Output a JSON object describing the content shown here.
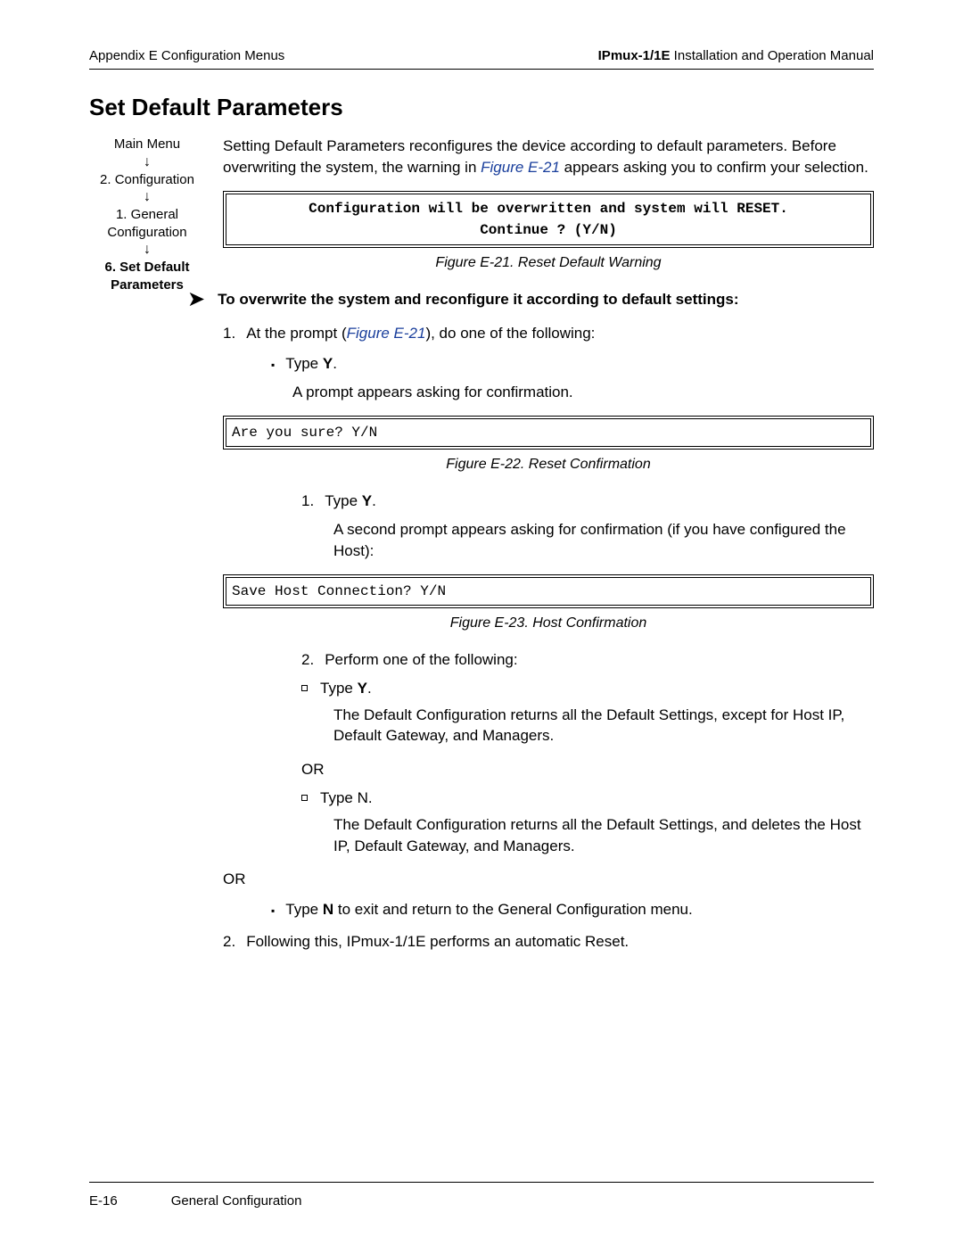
{
  "header": {
    "left": "Appendix E  Configuration Menus",
    "right_bold": "IPmux-1/1E",
    "right_rest": " Installation and Operation Manual"
  },
  "section_title": "Set Default Parameters",
  "sidebar": {
    "item1": "Main Menu",
    "item2": "2. Configuration",
    "item3": "1. General Configuration",
    "item4": "6. Set Default Parameters"
  },
  "intro": {
    "p1a": "Setting Default Parameters reconfigures the device according to default parameters. Before overwriting the system, the warning in ",
    "link1": "Figure E-21",
    "p1b": " appears asking you to confirm your selection."
  },
  "box1_line1": "Configuration will be overwritten and system will RESET.",
  "box1_line2": "Continue ? (Y/N)",
  "caption1": "Figure E-21.  Reset Default Warning",
  "proc_title": "To overwrite the system and reconfigure it according to default settings:",
  "step1_a": "At the prompt (",
  "step1_link": "Figure E-21",
  "step1_b": "), do one of the following:",
  "bullet_type_y_a": "Type ",
  "bullet_type_y_b": "Y",
  "bullet_type_y_c": ".",
  "result1": "A prompt appears asking for confirmation.",
  "box2": "Are you sure? Y/N",
  "caption2": "Figure E-22.  Reset Confirmation",
  "sub1_a": "Type ",
  "sub1_b": "Y",
  "sub1_c": ".",
  "sub_result1": "A second prompt appears asking for confirmation (if you have configured the Host):",
  "box3": "Save Host Connection? Y/N",
  "caption3": "Figure E-23.  Host Confirmation",
  "sub2": "Perform one of the following:",
  "sq1_a": "Type ",
  "sq1_b": "Y",
  "sq1_c": ".",
  "deep1": "The Default Configuration returns all the Default Settings, except for Host IP, Default Gateway, and Managers.",
  "or": "OR",
  "sq2": "Type N.",
  "deep2": "The Default Configuration returns all the Default Settings, and deletes the Host IP, Default Gateway, and Managers.",
  "bullet_n_a": "Type ",
  "bullet_n_b": "N",
  "bullet_n_c": " to exit and return to the General Configuration menu.",
  "step2": "Following this, IPmux-1/1E performs an automatic Reset.",
  "footer": {
    "page": "E-16",
    "section": "General Configuration"
  }
}
